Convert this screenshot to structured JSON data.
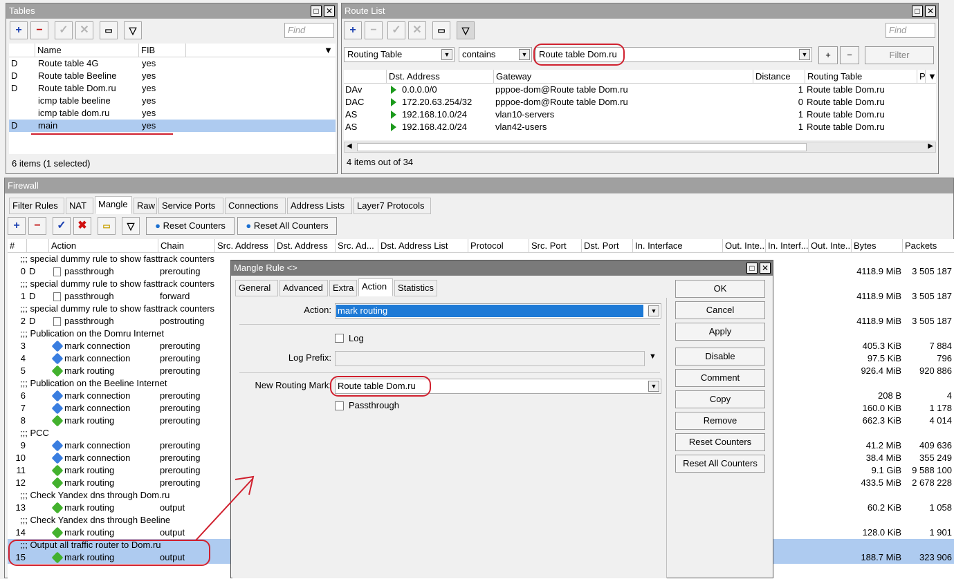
{
  "tables": {
    "title": "Tables",
    "find": "Find",
    "headers": [
      "Name",
      "FIB"
    ],
    "rows": [
      [
        "D",
        "Route table 4G",
        "yes"
      ],
      [
        "D",
        "Route table Beeline",
        "yes"
      ],
      [
        "D",
        "Route table Dom.ru",
        "yes"
      ],
      [
        "",
        "icmp table beeline",
        "yes"
      ],
      [
        "",
        "icmp table dom.ru",
        "yes"
      ],
      [
        "D",
        "main",
        "yes"
      ]
    ],
    "status": "6 items (1 selected)"
  },
  "routes": {
    "title": "Route List",
    "find": "Find",
    "filter_field": "Routing Table",
    "filter_op": "contains",
    "filter_value": "Route table Dom.ru",
    "filter_btn": "Filter",
    "headers": [
      "Dst. Address",
      "Gateway",
      "Distance",
      "Routing Table",
      "P"
    ],
    "rows": [
      [
        "DAv",
        "0.0.0.0/0",
        "pppoe-dom@Route table Dom.ru",
        "1",
        "Route table Dom.ru"
      ],
      [
        "DAC",
        "172.20.63.254/32",
        "pppoe-dom@Route table Dom.ru",
        "0",
        "Route table Dom.ru"
      ],
      [
        "AS",
        "192.168.10.0/24",
        "vlan10-servers",
        "1",
        "Route table Dom.ru"
      ],
      [
        "AS",
        "192.168.42.0/24",
        "vlan42-users",
        "1",
        "Route table Dom.ru"
      ]
    ],
    "status": "4 items out of 34"
  },
  "firewall": {
    "title": "Firewall",
    "tabs": [
      "Filter Rules",
      "NAT",
      "Mangle",
      "Raw",
      "Service Ports",
      "Connections",
      "Address Lists",
      "Layer7 Protocols"
    ],
    "reset_counters": "Reset Counters",
    "reset_all": "Reset All Counters",
    "headers": [
      "#",
      "Action",
      "Chain",
      "Src. Address",
      "Dst. Address",
      "Src. Ad...",
      "Dst. Address List",
      "Protocol",
      "Src. Port",
      "Dst. Port",
      "In. Interface",
      "Out. Inte...",
      "In. Interf...",
      "Out. Inte...",
      "Bytes",
      "Packets"
    ],
    "rows": [
      {
        "c": ";;; special dummy rule to show fasttrack counters"
      },
      {
        "n": "0",
        "f": "D",
        "i": "pt",
        "a": "passthrough",
        "ch": "prerouting",
        "b": "4118.9 MiB",
        "p": "3 505 187"
      },
      {
        "c": ";;; special dummy rule to show fasttrack counters"
      },
      {
        "n": "1",
        "f": "D",
        "i": "pt",
        "a": "passthrough",
        "ch": "forward",
        "b": "4118.9 MiB",
        "p": "3 505 187"
      },
      {
        "c": ";;; special dummy rule to show fasttrack counters"
      },
      {
        "n": "2",
        "f": "D",
        "i": "pt",
        "a": "passthrough",
        "ch": "postrouting",
        "b": "4118.9 MiB",
        "p": "3 505 187"
      },
      {
        "c": ";;; Publication on the Domru Internet"
      },
      {
        "n": "3",
        "f": "",
        "i": "mc",
        "a": "mark connection",
        "ch": "prerouting",
        "b": "405.3 KiB",
        "p": "7 884"
      },
      {
        "n": "4",
        "f": "",
        "i": "mc",
        "a": "mark connection",
        "ch": "prerouting",
        "b": "97.5 KiB",
        "p": "796"
      },
      {
        "n": "5",
        "f": "",
        "i": "mr",
        "a": "mark routing",
        "ch": "prerouting",
        "b": "926.4 MiB",
        "p": "920 886"
      },
      {
        "c": ";;; Publication on the Beeline Internet"
      },
      {
        "n": "6",
        "f": "",
        "i": "mc",
        "a": "mark connection",
        "ch": "prerouting",
        "b": "208 B",
        "p": "4"
      },
      {
        "n": "7",
        "f": "",
        "i": "mc",
        "a": "mark connection",
        "ch": "prerouting",
        "b": "160.0 KiB",
        "p": "1 178"
      },
      {
        "n": "8",
        "f": "",
        "i": "mr",
        "a": "mark routing",
        "ch": "prerouting",
        "b": "662.3 KiB",
        "p": "4 014"
      },
      {
        "c": ";;; PCC"
      },
      {
        "n": "9",
        "f": "",
        "i": "mc",
        "a": "mark connection",
        "ch": "prerouting",
        "b": "41.2 MiB",
        "p": "409 636"
      },
      {
        "n": "10",
        "f": "",
        "i": "mc",
        "a": "mark connection",
        "ch": "prerouting",
        "b": "38.4 MiB",
        "p": "355 249"
      },
      {
        "n": "11",
        "f": "",
        "i": "mr",
        "a": "mark routing",
        "ch": "prerouting",
        "b": "9.1 GiB",
        "p": "9 588 100"
      },
      {
        "n": "12",
        "f": "",
        "i": "mr",
        "a": "mark routing",
        "ch": "prerouting",
        "b": "433.5 MiB",
        "p": "2 678 228"
      },
      {
        "c": ";;; Check Yandex dns through Dom.ru"
      },
      {
        "n": "13",
        "f": "",
        "i": "mr",
        "a": "mark routing",
        "ch": "output",
        "b": "60.2 KiB",
        "p": "1 058"
      },
      {
        "c": ";;; Check Yandex dns through Beeline"
      },
      {
        "n": "14",
        "f": "",
        "i": "mr",
        "a": "mark routing",
        "ch": "output",
        "b": "128.0 KiB",
        "p": "1 901"
      },
      {
        "c": ";;; Output all traffic router to Dom.ru",
        "sel": true
      },
      {
        "n": "15",
        "f": "",
        "i": "mr",
        "a": "mark routing",
        "ch": "output",
        "b": "188.7 MiB",
        "p": "323 906",
        "sel": true
      }
    ]
  },
  "dialog": {
    "title": "Mangle Rule <>",
    "tabs": [
      "General",
      "Advanced",
      "Extra",
      "Action",
      "Statistics"
    ],
    "action_label": "Action:",
    "action_value": "mark routing",
    "log_label": "Log",
    "log_prefix_label": "Log Prefix:",
    "routing_mark_label": "New Routing Mark:",
    "routing_mark_value": "Route table Dom.ru",
    "passthrough_label": "Passthrough",
    "buttons": [
      "OK",
      "Cancel",
      "Apply",
      "Disable",
      "Comment",
      "Copy",
      "Remove",
      "Reset Counters",
      "Reset All Counters"
    ]
  }
}
